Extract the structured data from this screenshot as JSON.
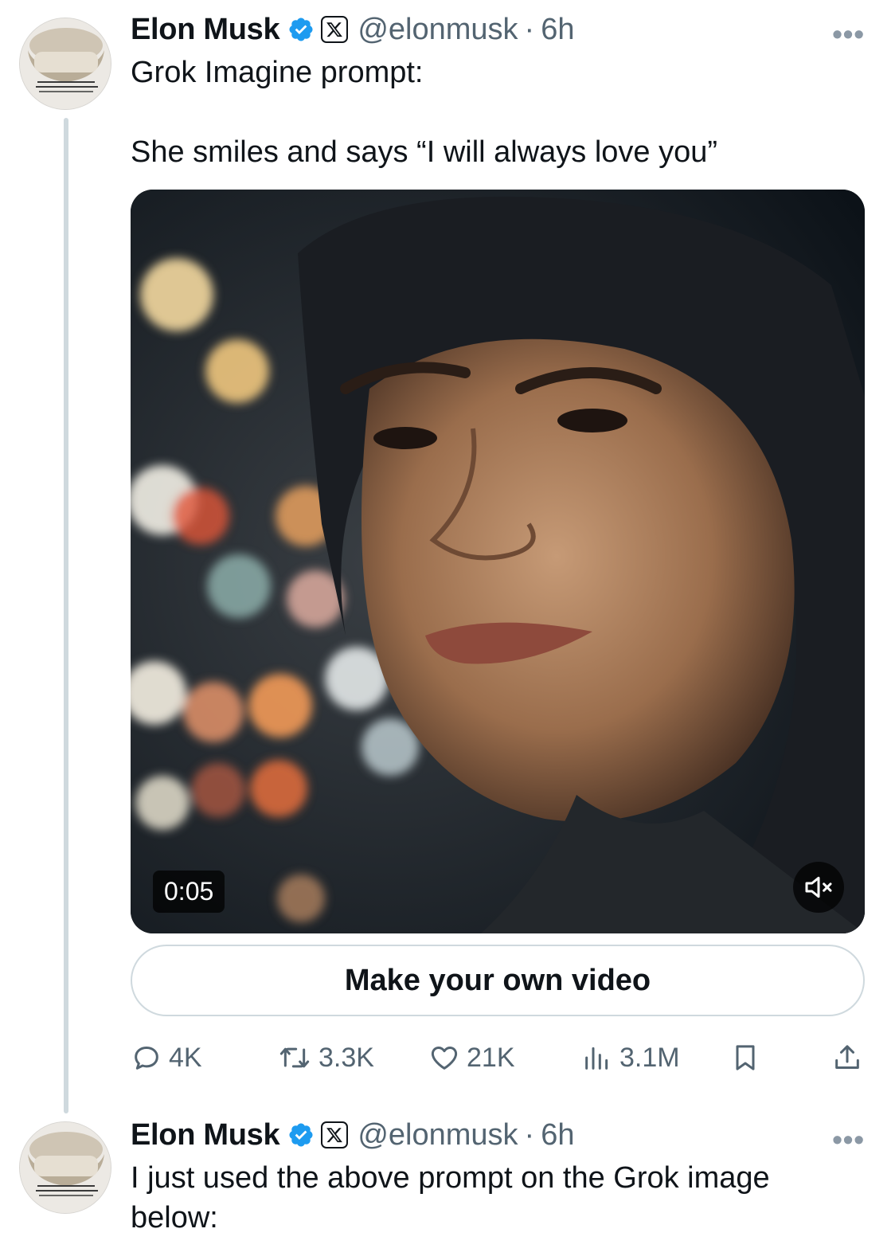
{
  "tweets": [
    {
      "author_name": "Elon Musk",
      "handle": "@elonmusk",
      "separator": "·",
      "time": "6h",
      "more": "•••",
      "text": "Grok Imagine prompt:\n\nShe smiles and says “I will always love you”",
      "video": {
        "duration": "0:05",
        "muted": true
      },
      "cta_label": "Make your own video",
      "stats": {
        "replies": "4K",
        "reposts": "3.3K",
        "likes": "21K",
        "views": "3.1M"
      }
    },
    {
      "author_name": "Elon Musk",
      "handle": "@elonmusk",
      "separator": "·",
      "time": "6h",
      "more": "•••",
      "text": "I just used the above prompt on the Grok image\nbelow:"
    }
  ],
  "colors": {
    "verified": "#1d9bf0",
    "secondary_text": "#536471",
    "primary_text": "#0f1419",
    "divider": "#cfd9de"
  },
  "icons": {
    "verified": "verified-badge-icon",
    "affiliate": "x-logo-icon",
    "reply": "reply-icon",
    "repost": "repost-icon",
    "like": "heart-icon",
    "views": "views-icon",
    "bookmark": "bookmark-icon",
    "share": "share-icon",
    "mute": "muted-speaker-icon"
  }
}
